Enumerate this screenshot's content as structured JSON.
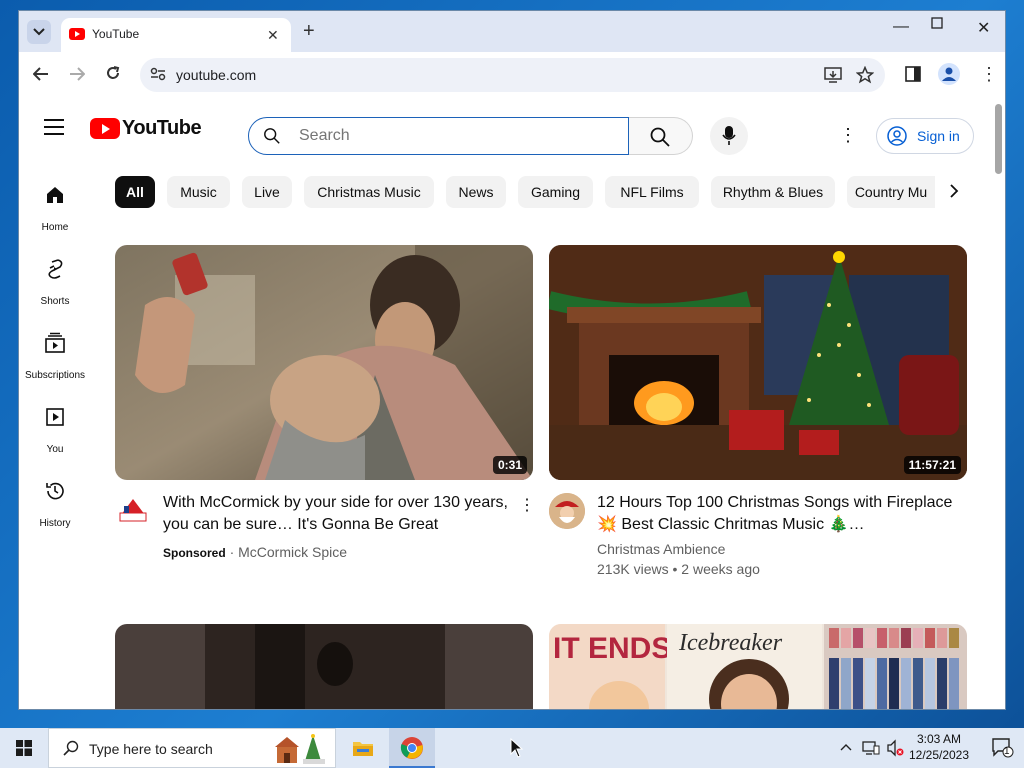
{
  "browser": {
    "tab_title": "YouTube",
    "url": "youtube.com"
  },
  "youtube": {
    "search_placeholder": "Search",
    "sign_in_label": "Sign in",
    "guide": [
      {
        "label": "Home",
        "icon": "home-icon"
      },
      {
        "label": "Shorts",
        "icon": "shorts-icon"
      },
      {
        "label": "Subscriptions",
        "icon": "subscriptions-icon"
      },
      {
        "label": "You",
        "icon": "you-icon"
      },
      {
        "label": "History",
        "icon": "history-icon"
      }
    ],
    "chips": [
      "All",
      "Music",
      "Live",
      "Christmas Music",
      "News",
      "Gaming",
      "NFL Films",
      "Rhythm & Blues",
      "Country Mu"
    ],
    "videos": [
      {
        "title": "With McCormick by your side for over 130 years, you can be sure… It's Gonna Be Great",
        "duration": "0:31",
        "sponsored_label": "Sponsored",
        "channel": "McCormick Spice"
      },
      {
        "title": "12 Hours Top 100 Christmas Songs with Fireplace 💥 Best Classic Chritmas Music 🎄…",
        "duration": "11:57:21",
        "channel": "Christmas Ambience",
        "views": "213K views",
        "age": "2 weeks ago"
      }
    ],
    "row2_thumb_texts": [
      "IT ENDS WITH US",
      "Icebreaker"
    ]
  },
  "taskbar": {
    "search_placeholder": "Type here to search",
    "time": "3:03 AM",
    "date": "12/25/2023",
    "notification_count": "1"
  },
  "colors": {
    "yt_red": "#ff0000",
    "link_blue": "#065fd4",
    "taskbar": "#dfe8f5"
  }
}
